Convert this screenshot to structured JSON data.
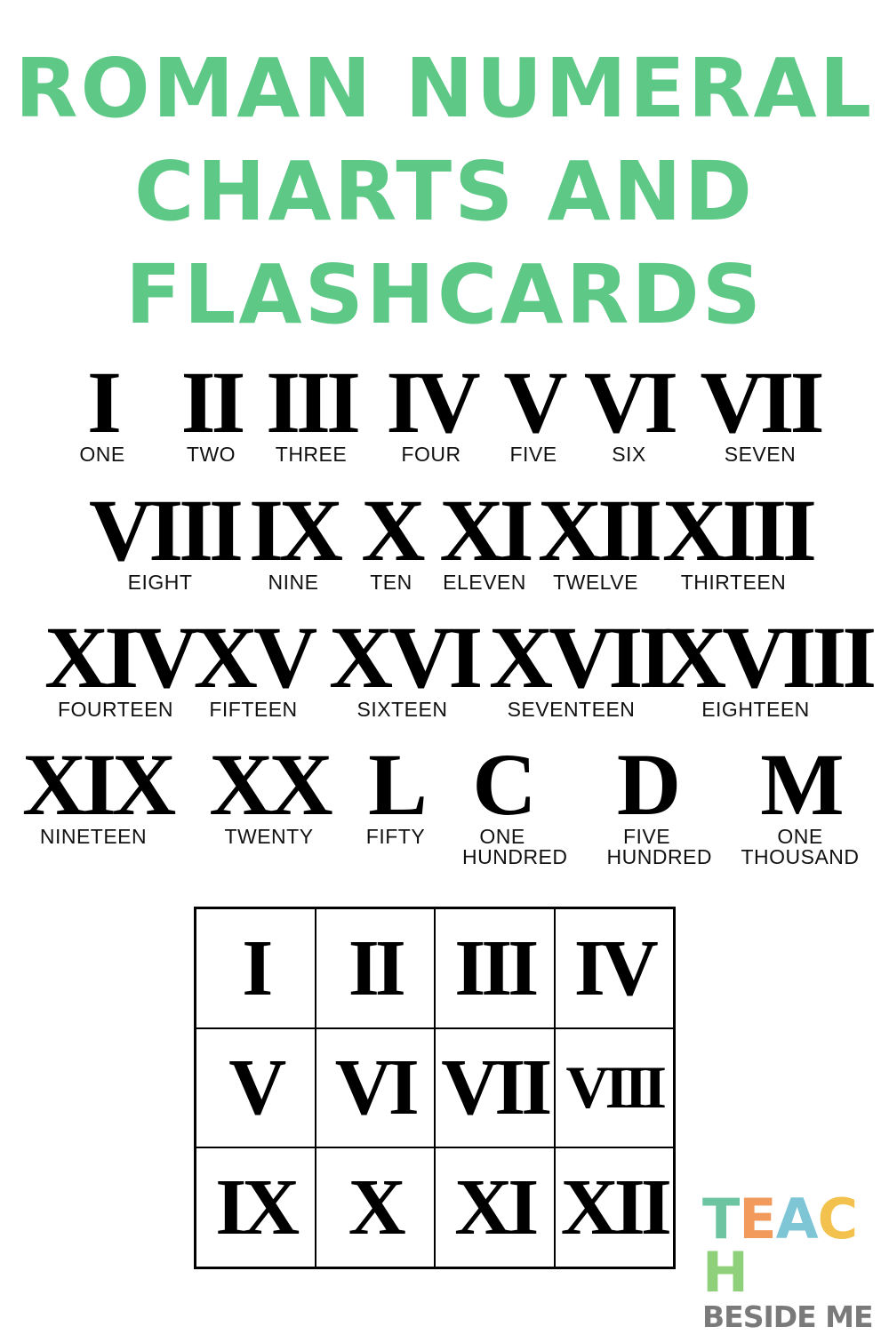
{
  "title": {
    "lines": [
      "ROMAN NUMERAL",
      "CHARTS AND",
      "FLASHCARDS"
    ],
    "color": "#5ec887"
  },
  "chart": [
    {
      "numeral": "I",
      "word": "ONE"
    },
    {
      "numeral": "II",
      "word": "TWO"
    },
    {
      "numeral": "III",
      "word": "THREE"
    },
    {
      "numeral": "IV",
      "word": "FOUR"
    },
    {
      "numeral": "V",
      "word": "FIVE"
    },
    {
      "numeral": "VI",
      "word": "SIX"
    },
    {
      "numeral": "VII",
      "word": "SEVEN"
    },
    {
      "numeral": "VIII",
      "word": "EIGHT"
    },
    {
      "numeral": "IX",
      "word": "NINE"
    },
    {
      "numeral": "X",
      "word": "TEN"
    },
    {
      "numeral": "XI",
      "word": "ELEVEN"
    },
    {
      "numeral": "XII",
      "word": "TWELVE"
    },
    {
      "numeral": "XIII",
      "word": "THIRTEEN"
    },
    {
      "numeral": "XIV",
      "word": "FOURTEEN"
    },
    {
      "numeral": "XV",
      "word": "FIFTEEN"
    },
    {
      "numeral": "XVI",
      "word": "SIXTEEN"
    },
    {
      "numeral": "XVII",
      "word": "SEVENTEEN"
    },
    {
      "numeral": "XVIII",
      "word": "EIGHTEEN"
    },
    {
      "numeral": "XIX",
      "word": "NINETEEN"
    },
    {
      "numeral": "XX",
      "word": "TWENTY"
    },
    {
      "numeral": "L",
      "word": "FIFTY"
    },
    {
      "numeral": "C",
      "word": "ONE HUNDRED"
    },
    {
      "numeral": "D",
      "word": "FIVE HUNDRED"
    },
    {
      "numeral": "M",
      "word": "ONE THOUSAND"
    }
  ],
  "flashcards": [
    "I",
    "II",
    "III",
    "IV",
    "V",
    "VI",
    "VII",
    "VIII",
    "IX",
    "X",
    "XI",
    "XII"
  ],
  "logo": {
    "teach_letters": [
      "T",
      "E",
      "A",
      "C",
      "H"
    ],
    "teach_colors": [
      "#6cc5a0",
      "#f29a5c",
      "#7ec6d6",
      "#f2c14e",
      "#8fd17a"
    ],
    "beside": "BESIDE ME",
    "beside_color": "#7a7a7a"
  }
}
